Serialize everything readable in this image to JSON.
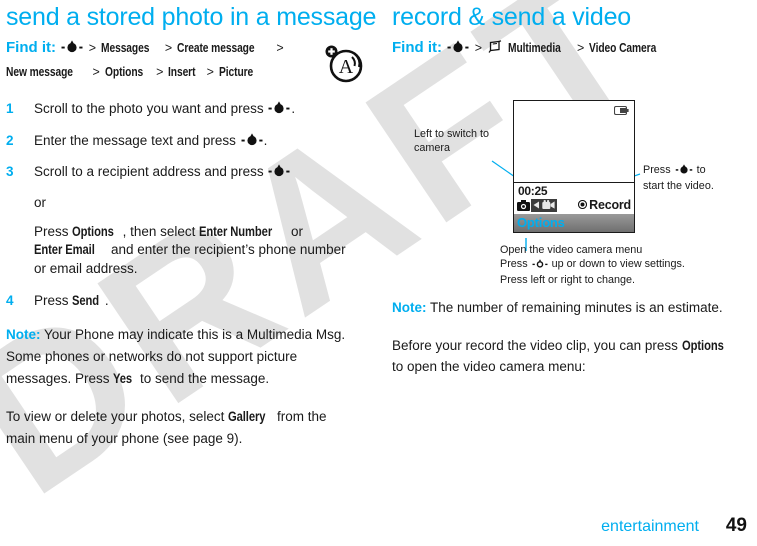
{
  "watermark": {
    "text": "DRAFT"
  },
  "left_column": {
    "title": "send a stored photo in a message",
    "find_it": {
      "label": "Find it:",
      "nav_icon": "navigation-key-icon",
      "path": [
        "Messages",
        "Create message",
        "New message",
        "Options",
        "Insert",
        "Picture"
      ],
      "separator": ">"
    },
    "audio_icon": "audio-assist-plus-icon",
    "steps": [
      {
        "num": "1",
        "text_before": "Scroll to the photo you want and press",
        "icon": "navigation-key-icon",
        "text_after": "."
      },
      {
        "num": "2",
        "text_before": "Enter the message text and press",
        "icon": "navigation-key-icon",
        "text_after": "."
      },
      {
        "num": "3",
        "text_before": "Scroll to a recipient address and press",
        "icon": "navigation-key-icon",
        "text_after": "",
        "or_text": "or",
        "sub_parts": [
          "Press ",
          "Options",
          ", then select ",
          "Enter Number",
          " or ",
          "Enter Email",
          " and enter the recipient’s phone number or email address."
        ]
      },
      {
        "num": "4",
        "text_before": "Press",
        "bold": "Send",
        "text_after": "."
      }
    ],
    "note": {
      "label": "Note:",
      "part1": "Your Phone may indicate this is a Multimedia Msg. Some phones or networks do not support picture messages. Press ",
      "bold": "Yes",
      "part2": " to send the message."
    },
    "closing": {
      "part1": "To view or delete your photos, select ",
      "bold": "Gallery",
      "part2": " from the main menu of your phone (see page 9)."
    }
  },
  "right_column": {
    "title": "record & send a video",
    "find_it": {
      "label": "Find it:",
      "nav_icon": "navigation-key-icon",
      "menu_icon": "multimedia-icon",
      "path": [
        "Multimedia",
        "Video Camera"
      ],
      "separator": ">"
    },
    "figure": {
      "phone_screen": {
        "battery_icon": "battery-icon",
        "timer": "00:25",
        "camera_icon": "still-camera-icon",
        "left_arrow_icon": "left-arrow-icon",
        "video_icon": "video-camera-icon",
        "record_bullet_icon": "record-dot-icon",
        "record_label": "Record",
        "softkey_label": "Options"
      },
      "callouts": {
        "left": "Left to switch to camera",
        "right_line1": "Press",
        "right_icon": "navigation-key-icon",
        "right_line1_end": "to",
        "right_line2": "start the video.",
        "bottom_line1": "Open the video camera menu",
        "bottom_line2_a": "Press",
        "bottom_line2_icon": "navigation-key-icon",
        "bottom_line2_b": "up or down to view settings.",
        "bottom_line3": "Press left or right to change."
      }
    },
    "note": {
      "label": "Note:",
      "text": "The number of remaining minutes is an estimate."
    },
    "closing": {
      "part1": "Before your record the video clip, you can press ",
      "bold": "Options",
      "part2": " to open the video camera menu:"
    }
  },
  "footer": {
    "section": "entertainment",
    "page": "49"
  },
  "colors": {
    "accent": "#00AEEF",
    "text": "#1A1A1A",
    "softkey_bar": "#7F7F7F",
    "watermark": "#CFCFCF"
  }
}
